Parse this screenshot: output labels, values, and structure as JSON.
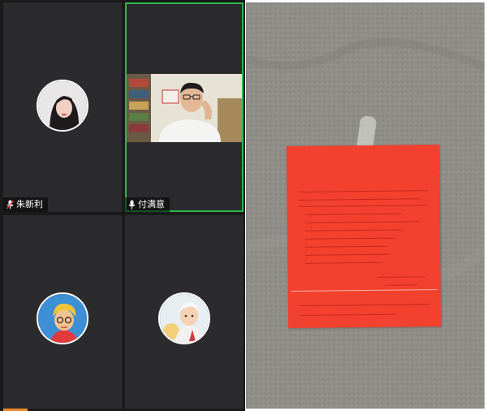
{
  "participants": [
    {
      "name": "朱新利",
      "mic": "muted"
    },
    {
      "name": "付满意",
      "mic": "on"
    },
    {
      "name": ""
    },
    {
      "name": ""
    }
  ],
  "colors": {
    "active_speaker_border": "#2db84a",
    "tile_background": "#2b2b2d",
    "notice_paper": "#f2412f"
  }
}
